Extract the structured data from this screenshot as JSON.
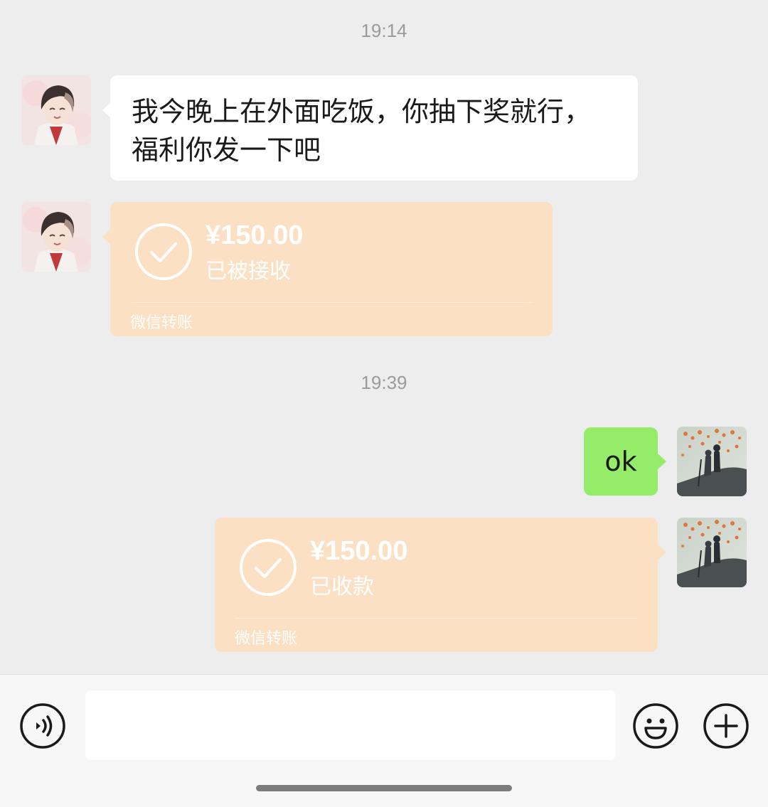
{
  "chat": {
    "timestamp_1": "19:14",
    "timestamp_2": "19:39",
    "msg_1": {
      "line_1": "我今晚上在外面吃饭，你抽下奖就行，",
      "line_2": "福利你发一下吧"
    },
    "transfer_1": {
      "amount": "¥150.00",
      "status": "已被接收",
      "footer": "微信转账"
    },
    "msg_2": "ok",
    "transfer_2": {
      "amount": "¥150.00",
      "status": "已收款",
      "footer": "微信转账"
    }
  },
  "input_bar": {
    "voice_icon": "voice-icon",
    "emoji_icon": "emoji-icon",
    "plus_icon": "plus-icon",
    "input_value": ""
  },
  "colors": {
    "background": "#ededed",
    "green_bubble": "#95ec69",
    "transfer_bubble": "#fbe0c4"
  }
}
